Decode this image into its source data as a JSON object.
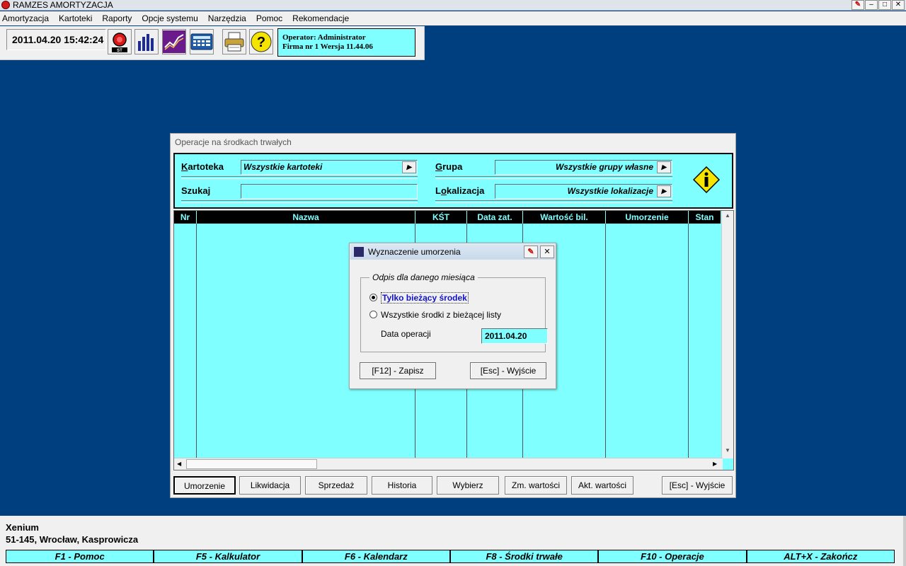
{
  "window": {
    "title": "RAMZES AMORTYZACJA"
  },
  "menu": [
    "Amortyzacja",
    "Kartoteki",
    "Raporty",
    "Opcje systemu",
    "Narzędzia",
    "Pomoc",
    "Rekomendacje"
  ],
  "toolbar": {
    "datetime": "2011.04.20 15:42:24",
    "st_label": "ST",
    "operator_line": "Operator: Administrator",
    "firm_line": "Firma nr 1   Wersja 11.44.06"
  },
  "main": {
    "title": "Operacje na środkach trwałych",
    "filters": {
      "kartoteka_label": "Kartoteka",
      "kartoteka_value": "Wszystkie kartoteki",
      "szukaj_label": "Szukaj",
      "szukaj_value": "",
      "grupa_label": "Grupa",
      "grupa_value": "Wszystkie grupy własne",
      "lokalizacja_label": "Lokalizacja",
      "lokalizacja_value": "Wszystkie lokalizacje"
    },
    "columns": [
      "Nr",
      "Nazwa",
      "KŚT",
      "Data zat.",
      "Wartość bil.",
      "Umorzenie",
      "Stan"
    ],
    "buttons": [
      "Umorzenie",
      "Likwidacja",
      "Sprzedaż",
      "Historia",
      "Wybierz",
      "Zm. wartości",
      "Akt. wartości",
      "[Esc] - Wyjście"
    ]
  },
  "dialog": {
    "title": "Wyznaczenie umorzenia",
    "group_label": "Odpis dla danego miesiąca",
    "option1": "Tylko bieżący środek",
    "option2": "Wszystkie środki z bieżącej listy",
    "selected_option": "option1",
    "date_label": "Data operacji",
    "date_value": "2011.04.20",
    "save_button": "[F12] - Zapisz",
    "exit_button": "[Esc] - Wyjście"
  },
  "footer": {
    "company_name": "Xenium",
    "company_address": "51-145, Wrocław, Kasprowicza",
    "fkeys": [
      "F1 - Pomoc",
      "F5 - Kalkulator",
      "F6 - Kalendarz",
      "F8 - Środki trwałe",
      "F10 - Operacje",
      "ALT+X - Zakończ"
    ]
  },
  "colors": {
    "desktop": "#003f7f",
    "cyan": "#7fffff",
    "selected_text": "#1212c8"
  }
}
